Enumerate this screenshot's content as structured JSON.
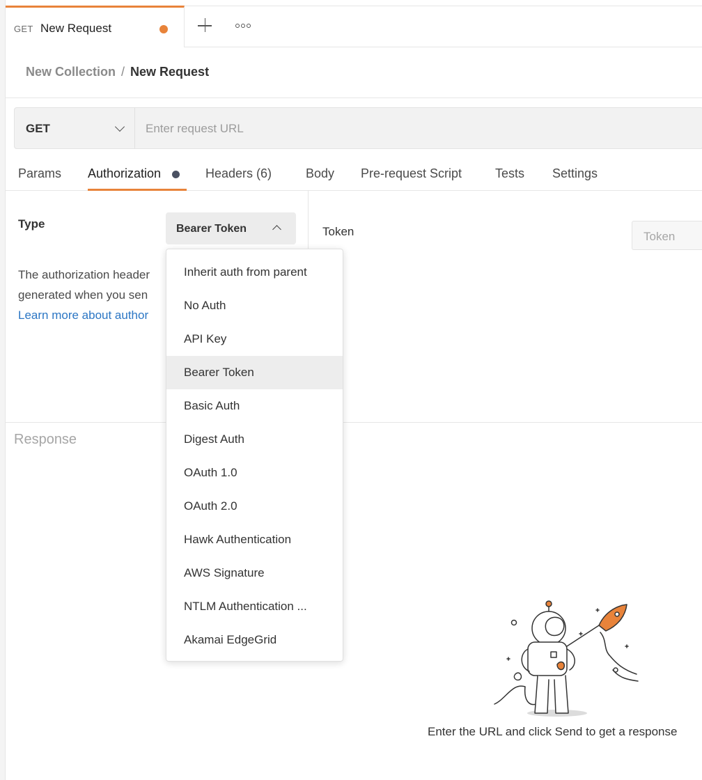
{
  "tab": {
    "method": "GET",
    "name": "New Request"
  },
  "breadcrumb": {
    "collection": "New Collection",
    "separator": "/",
    "request": "New Request"
  },
  "urlbar": {
    "method": "GET",
    "placeholder": "Enter request URL"
  },
  "request_tabs": [
    "Params",
    "Authorization",
    "Headers (6)",
    "Body",
    "Pre-request Script",
    "Tests",
    "Settings"
  ],
  "auth": {
    "type_label": "Type",
    "type_value": "Bearer Token",
    "desc_line1": "The authorization header",
    "desc_line2": "generated when you sen",
    "desc_link": "Learn more about author",
    "token_label": "Token",
    "token_placeholder": "Token"
  },
  "dropdown_items": [
    "Inherit auth from parent",
    "No Auth",
    "API Key",
    "Bearer Token",
    "Basic Auth",
    "Digest Auth",
    "OAuth 1.0",
    "OAuth 2.0",
    "Hawk Authentication",
    "AWS Signature",
    "NTLM Authentication ...",
    "Akamai EdgeGrid"
  ],
  "selected_item": "Bearer Token",
  "response": {
    "title": "Response",
    "empty_message": "Enter the URL and click Send to get a response"
  },
  "colors": {
    "accent": "#e8833a",
    "link": "#2b76c4",
    "indicator": "#4a5162"
  },
  "icons": [
    "plus-icon",
    "more-options-icon",
    "chevron-down-icon",
    "chevron-up-icon",
    "astronaut-rocket-illustration"
  ]
}
